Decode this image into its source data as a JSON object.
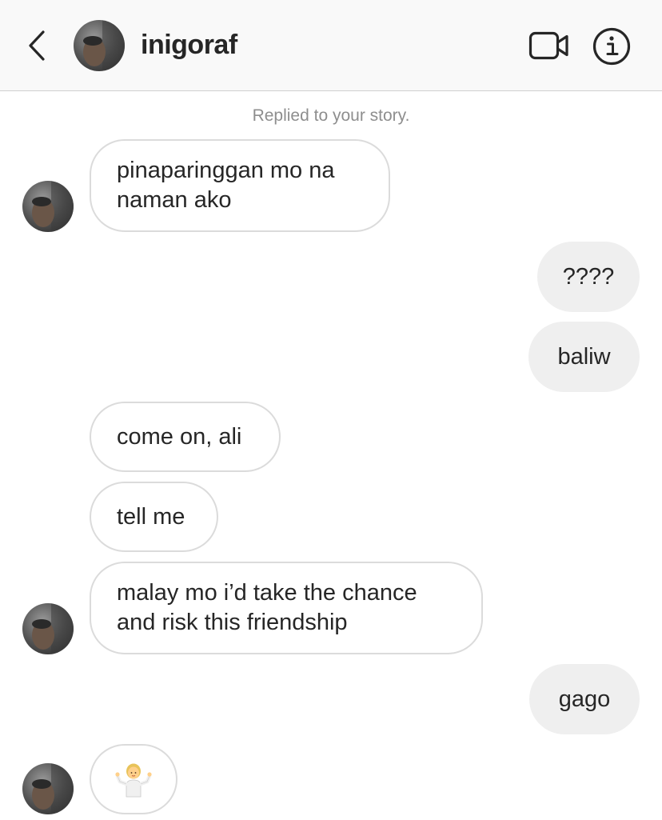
{
  "header": {
    "username": "inigoraf",
    "back_icon": "chevron-left-icon",
    "video_icon": "video-call-icon",
    "info_icon": "info-icon"
  },
  "thread": {
    "replied_note": "Replied to your story.",
    "messages": [
      {
        "from": "them",
        "lines": [
          "pinaparinggan mo na",
          "naman ako"
        ]
      },
      {
        "from": "me",
        "text": "????"
      },
      {
        "from": "me",
        "text": "baliw"
      },
      {
        "from": "them",
        "text": "come on, ali"
      },
      {
        "from": "them",
        "text": "tell me"
      },
      {
        "from": "them",
        "lines": [
          "malay mo i’d take the chance",
          "and risk this friendship"
        ]
      },
      {
        "from": "me",
        "text": "gago"
      },
      {
        "from": "them",
        "emoji": "person-shrugging-emoji"
      }
    ]
  },
  "colors": {
    "header_bg": "#f9f9f9",
    "outgoing_bubble": "#efefef",
    "incoming_border": "#dbdbdb",
    "muted_text": "#8e8e8e",
    "text": "#262626"
  }
}
